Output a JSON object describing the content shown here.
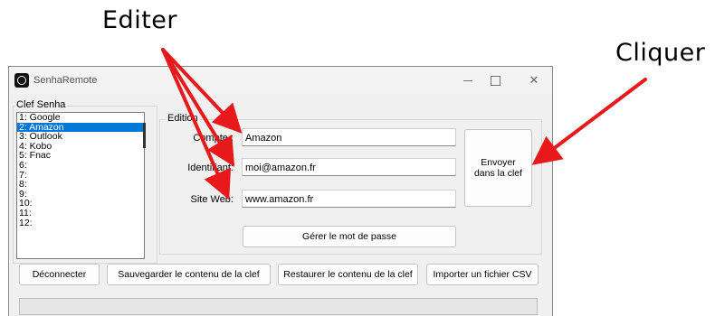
{
  "annotations": {
    "edit_label": "Editer",
    "click_label": "Cliquer",
    "arrow_color": "#e8191a"
  },
  "window": {
    "title": "SenhaRemote",
    "minimize_icon": "minimize-icon",
    "maximize_icon": "maximize-icon",
    "close_icon": "close-icon",
    "close_glyph": "✕"
  },
  "key_group": {
    "label": "Clef Senha",
    "items": [
      "1: Google",
      "2: Amazon",
      "3: Outlook",
      "4: Kobo",
      "5: Fnac",
      "6:",
      "7:",
      "8:",
      "9:",
      "10:",
      "11:",
      "12:"
    ],
    "selected_item": "2: Amazon"
  },
  "edition": {
    "label": "Edition",
    "compte_label": "Compte :",
    "compte_value": "Amazon",
    "identifiant_label": "Identifiant:",
    "identifiant_value": "moi@amazon.fr",
    "site_label": "Site Web:",
    "site_value": "www.amazon.fr",
    "password_button": "Gérer le mot de passe",
    "send_button_line1": "Envoyer",
    "send_button_line2": "dans la clef"
  },
  "bottom_buttons": {
    "disconnect": "Déconnecter",
    "save": "Sauvegarder le contenu de la clef",
    "restore": "Restaurer le contenu de la clef",
    "import_csv": "Importer un fichier CSV"
  },
  "status": {
    "text": ""
  }
}
